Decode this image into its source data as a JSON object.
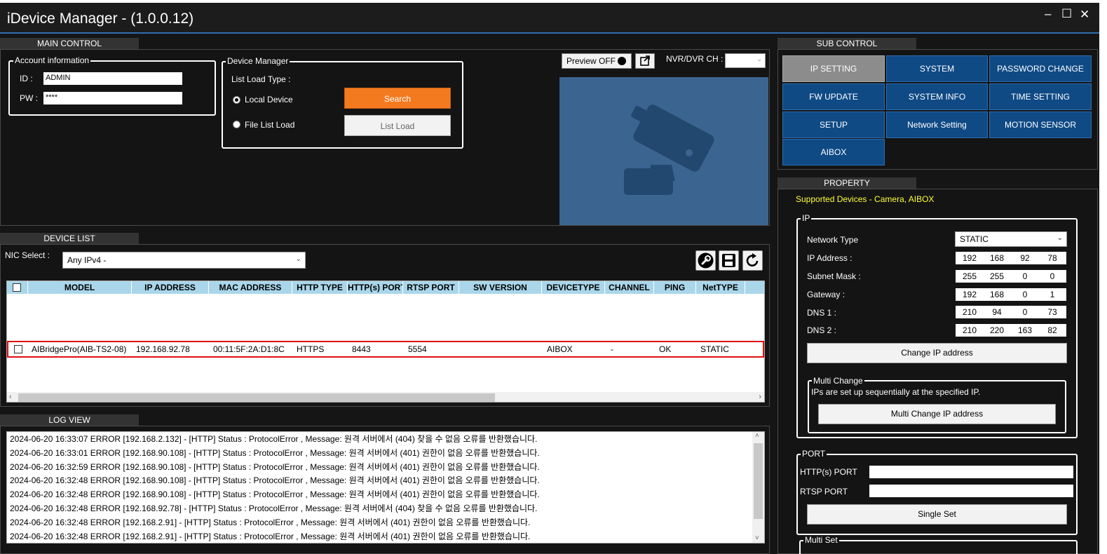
{
  "window": {
    "title": "iDevice Manager - (1.0.0.12)",
    "minimize_glyph": "–",
    "maximize_glyph": "☐",
    "close_glyph": "✕"
  },
  "main_control": {
    "tab_label": "MAIN CONTROL",
    "account": {
      "title": "Account information",
      "id_label": "ID :",
      "id_value": "ADMIN",
      "pw_label": "PW :",
      "pw_value": "****"
    },
    "device_manager": {
      "title": "Device Manager",
      "list_load_type_label": "List Load Type :",
      "local_device_label": "Local Device",
      "file_list_load_label": "File List Load",
      "search_label": "Search",
      "list_load_label": "List Load"
    },
    "preview": {
      "preview_label": "Preview OFF",
      "nvr_label": "NVR/DVR CH :"
    }
  },
  "sub_control": {
    "tab_label": "SUB CONTROL",
    "buttons": [
      "IP SETTING",
      "SYSTEM",
      "PASSWORD CHANGE",
      "FW UPDATE",
      "SYSTEM INFO",
      "TIME SETTING",
      "SETUP",
      "Network Setting",
      "MOTION SENSOR",
      "AIBOX"
    ]
  },
  "device_list": {
    "tab_label": "DEVICE LIST",
    "nic_label": "NIC Select :",
    "nic_value": "Any IPv4 -",
    "columns": [
      "MODEL",
      "IP ADDRESS",
      "MAC ADDRESS",
      "HTTP TYPE",
      "HTTP(s) PORT",
      "RTSP PORT",
      "SW VERSION",
      "DEVICETYPE",
      "CHANNEL",
      "PING",
      "NetTYPE"
    ],
    "rows": [
      {
        "model": "AIBridgePro(AIB-TS2-08)",
        "ip": "192.168.92.78",
        "mac": "00:11:5F:2A:D1:8C",
        "http_type": "HTTPS",
        "http_port": "8443",
        "rtsp_port": "5554",
        "sw_version": "",
        "device_type": "AIBOX",
        "channel": "-",
        "ping": "OK",
        "net_type": "STATIC"
      }
    ]
  },
  "log_view": {
    "tab_label": "LOG VIEW",
    "lines": [
      "2024-06-20 16:33:07 ERROR [192.168.2.132] - [HTTP] Status : ProtocolError , Message: 원격 서버에서 (404) 찾을 수 없음 오류를 반환했습니다.",
      "2024-06-20 16:33:01 ERROR [192.168.90.108] - [HTTP] Status : ProtocolError , Message: 원격 서버에서 (401) 권한이 없음 오류를 반환했습니다.",
      "2024-06-20 16:32:59 ERROR [192.168.90.108] - [HTTP] Status : ProtocolError , Message: 원격 서버에서 (401) 권한이 없음 오류를 반환했습니다.",
      "2024-06-20 16:32:48 ERROR [192.168.90.108] - [HTTP] Status : ProtocolError , Message: 원격 서버에서 (401) 권한이 없음 오류를 반환했습니다.",
      "2024-06-20 16:32:48 ERROR [192.168.90.108] - [HTTP] Status : ProtocolError , Message: 원격 서버에서 (401) 권한이 없음 오류를 반환했습니다.",
      "2024-06-20 16:32:48 ERROR [192.168.92.78] - [HTTP] Status : ProtocolError , Message: 원격 서버에서 (404) 찾을 수 없음 오류를 반환했습니다.",
      "2024-06-20 16:32:48 ERROR [192.168.2.91] - [HTTP] Status : ProtocolError , Message: 원격 서버에서 (401) 권한이 없음 오류를 반환했습니다.",
      "2024-06-20 16:32:48 ERROR [192.168.2.91] - [HTTP] Status : ProtocolError , Message: 원격 서버에서 (401) 권한이 없음 오류를 반환했습니다."
    ]
  },
  "property": {
    "tab_label": "PROPERTY",
    "supported": "Supported Devices - Camera, AIBOX",
    "ip_group": {
      "title": "IP",
      "network_type_label": "Network Type",
      "network_type_value": "STATIC",
      "ip_label": "IP Address :",
      "ip": [
        "192",
        "168",
        "92",
        "78"
      ],
      "subnet_label": "Subnet Mask :",
      "subnet": [
        "255",
        "255",
        "0",
        "0"
      ],
      "gateway_label": "Gateway :",
      "gateway": [
        "192",
        "168",
        "0",
        "1"
      ],
      "dns1_label": "DNS 1 :",
      "dns1": [
        "210",
        "94",
        "0",
        "73"
      ],
      "dns2_label": "DNS 2 :",
      "dns2": [
        "210",
        "220",
        "163",
        "82"
      ],
      "change_ip_label": "Change IP address"
    },
    "multi_change": {
      "title": "Multi Change",
      "description": "IPs are set up sequentially at the specified IP.",
      "button_label": "Multi Change IP address"
    },
    "port_group": {
      "title": "PORT",
      "http_label": "HTTP(s) PORT",
      "http_value": "",
      "rtsp_label": "RTSP PORT",
      "rtsp_value": "",
      "single_set_label": "Single Set"
    },
    "multi_set_title": "Multi Set"
  },
  "colors": {
    "accent_blue": "#0f4a85",
    "search_orange": "#f47a20",
    "grid_header": "#a9d6ea",
    "selection_red": "#e01010",
    "supported_yellow": "#ffff33"
  }
}
